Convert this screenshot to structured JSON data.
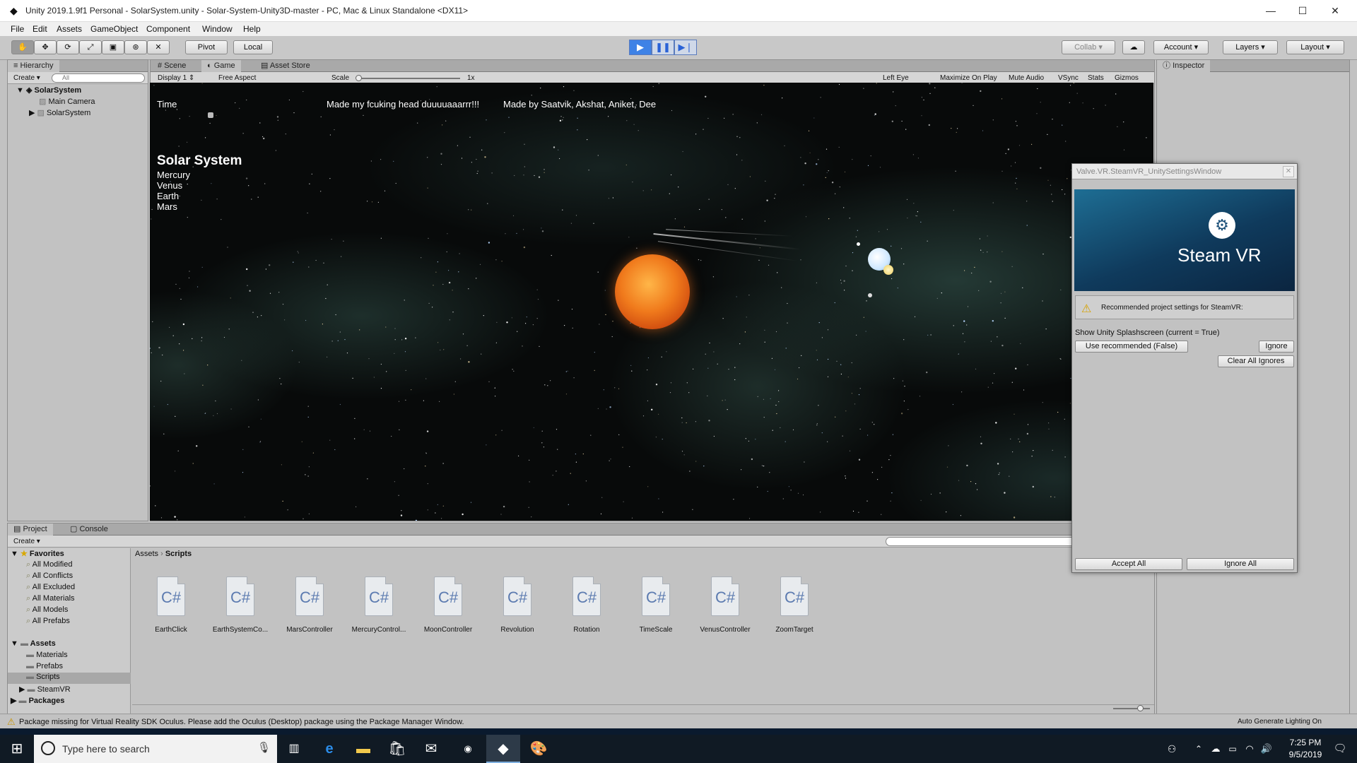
{
  "window": {
    "title": "Unity 2019.1.9f1 Personal - SolarSystem.unity - Solar-System-Unity3D-master - PC, Mac & Linux Standalone <DX11>",
    "minimize": "—",
    "maximize": "☐",
    "close": "✕"
  },
  "menu": [
    "File",
    "Edit",
    "Assets",
    "GameObject",
    "Component",
    "Window",
    "Help"
  ],
  "toolbar": {
    "pivot": "Pivot",
    "local": "Local",
    "collab": "Collab",
    "account": "Account",
    "layers": "Layers",
    "layout": "Layout"
  },
  "hierarchy": {
    "tab": "Hierarchy",
    "create": "Create",
    "search_placeholder": "All",
    "scene": "SolarSystem",
    "items": [
      "Main Camera",
      "SolarSystem"
    ]
  },
  "game_tabs": {
    "scene": "Scene",
    "game": "Game",
    "asset_store": "Asset Store"
  },
  "game_bar": {
    "display": "Display 1",
    "aspect": "Free Aspect",
    "scale_label": "Scale",
    "scale_value": "1x",
    "eye": "Left Eye",
    "maximize": "Maximize On Play",
    "mute": "Mute Audio",
    "vsync": "VSync",
    "stats": "Stats",
    "gizmos": "Gizmos"
  },
  "game": {
    "time": "Time",
    "msg1": "Made my fcuking head duuuuaaarrr!!!",
    "msg2": "Made by Saatvik, Akshat, Aniket, Dee",
    "heading": "Solar System",
    "planets": [
      "Mercury",
      "Venus",
      "Earth",
      "Mars"
    ]
  },
  "inspector": {
    "tab": "Inspector"
  },
  "steamvr": {
    "title": "Valve.VR.SteamVR_UnitySettingsWindow",
    "logo": "Steam VR",
    "notice": "Recommended project settings for SteamVR:",
    "setting": "Show Unity Splashscreen (current = True)",
    "use_recommended": "Use recommended (False)",
    "ignore": "Ignore",
    "clear_all": "Clear All Ignores",
    "accept_all": "Accept All",
    "ignore_all": "Ignore All"
  },
  "project": {
    "tab": "Project",
    "console_tab": "Console",
    "create": "Create",
    "favorites_label": "Favorites",
    "favorites": [
      "All Modified",
      "All Conflicts",
      "All Excluded",
      "All Materials",
      "All Models",
      "All Prefabs"
    ],
    "assets_label": "Assets",
    "folders": [
      "Materials",
      "Prefabs",
      "Scripts",
      "SteamVR"
    ],
    "packages_label": "Packages",
    "breadcrumb_root": "Assets",
    "breadcrumb_sep": "›",
    "breadcrumb_current": "Scripts",
    "scripts": [
      "EarthClick",
      "EarthSystemCo...",
      "MarsController",
      "MercuryControl...",
      "MoonController",
      "Revolution",
      "Rotation",
      "TimeScale",
      "VenusController",
      "ZoomTarget"
    ],
    "script_glyph": "C#"
  },
  "status": {
    "message": "Package missing for Virtual Reality SDK Oculus. Please add the Oculus (Desktop) package using the Package Manager Window.",
    "lighting": "Auto Generate Lighting On"
  },
  "taskbar": {
    "search_placeholder": "Type here to search",
    "time": "7:25 PM",
    "date": "9/5/2019"
  },
  "colors": {
    "play_active": "#3e82e6",
    "taskbar": "#101a24",
    "sun": "#e8701a"
  }
}
